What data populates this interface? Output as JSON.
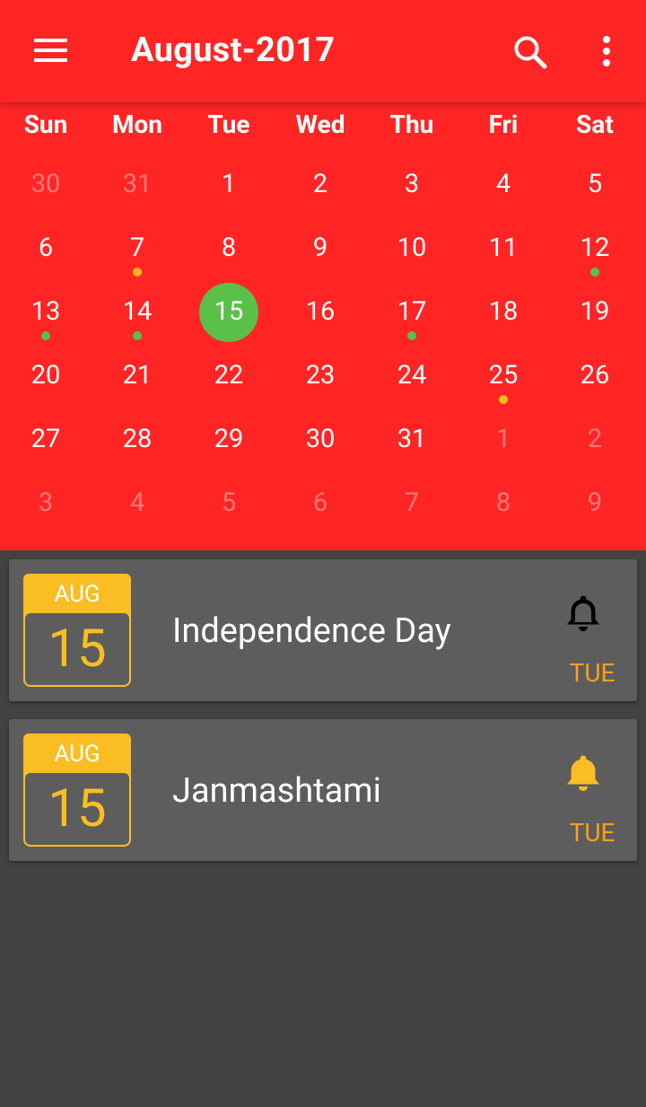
{
  "toolbar": {
    "title": "August-2017",
    "icons": {
      "menu": "menu-icon",
      "search": "search-icon",
      "more": "more-vert-icon"
    }
  },
  "colors": {
    "primary": "#ff2525",
    "today": "#5ac04a",
    "dot_green": "#5ac04a",
    "dot_orange": "#ffb81f",
    "accent": "#fbbd24",
    "weekday_label": "#ff9f1a",
    "card_bg": "#5d5d5d",
    "page_bg": "#424242"
  },
  "calendar": {
    "weekdays": [
      "Sun",
      "Mon",
      "Tue",
      "Wed",
      "Thu",
      "Fri",
      "Sat"
    ],
    "today": "15",
    "weeks": [
      [
        {
          "d": "30",
          "other": true
        },
        {
          "d": "31",
          "other": true
        },
        {
          "d": "1"
        },
        {
          "d": "2"
        },
        {
          "d": "3"
        },
        {
          "d": "4"
        },
        {
          "d": "5"
        }
      ],
      [
        {
          "d": "6"
        },
        {
          "d": "7",
          "dot": "orange"
        },
        {
          "d": "8"
        },
        {
          "d": "9"
        },
        {
          "d": "10"
        },
        {
          "d": "11"
        },
        {
          "d": "12",
          "dot": "green"
        }
      ],
      [
        {
          "d": "13",
          "dot": "green"
        },
        {
          "d": "14",
          "dot": "green"
        },
        {
          "d": "15",
          "today": true
        },
        {
          "d": "16"
        },
        {
          "d": "17",
          "dot": "green"
        },
        {
          "d": "18"
        },
        {
          "d": "19"
        }
      ],
      [
        {
          "d": "20"
        },
        {
          "d": "21"
        },
        {
          "d": "22"
        },
        {
          "d": "23"
        },
        {
          "d": "24"
        },
        {
          "d": "25",
          "dot": "orange"
        },
        {
          "d": "26"
        }
      ],
      [
        {
          "d": "27"
        },
        {
          "d": "28"
        },
        {
          "d": "29"
        },
        {
          "d": "30"
        },
        {
          "d": "31"
        },
        {
          "d": "1",
          "other": true
        },
        {
          "d": "2",
          "other": true
        }
      ],
      [
        {
          "d": "3",
          "other": true
        },
        {
          "d": "4",
          "other": true
        },
        {
          "d": "5",
          "other": true
        },
        {
          "d": "6",
          "other": true
        },
        {
          "d": "7",
          "other": true
        },
        {
          "d": "8",
          "other": true
        },
        {
          "d": "9",
          "other": true
        }
      ]
    ]
  },
  "events": [
    {
      "month": "AUG",
      "day": "15",
      "title": "Independence Day",
      "weekday": "TUE",
      "bell_color": "#000000",
      "bell_icon": "bell-icon"
    },
    {
      "month": "AUG",
      "day": "15",
      "title": "Janmashtami",
      "weekday": "TUE",
      "bell_color": "#fbbd24",
      "bell_icon": "bell-icon"
    }
  ]
}
